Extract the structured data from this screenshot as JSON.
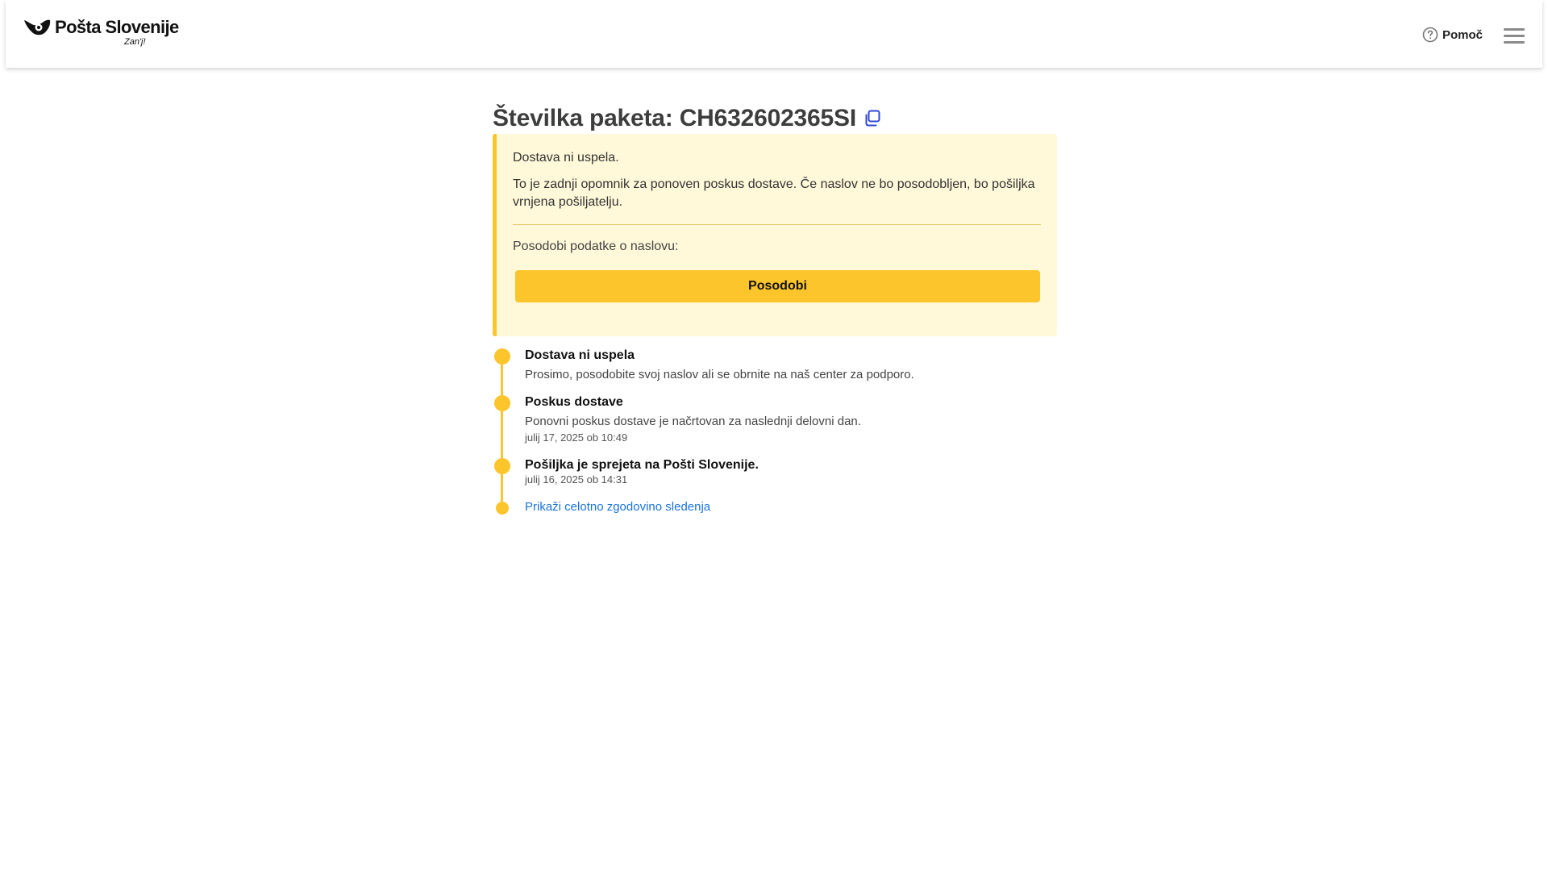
{
  "header": {
    "logo_name": "Pošta Slovenije",
    "logo_tagline": "Zan'j!",
    "help_label": "Pomoč",
    "menu_icon": "hamburger-menu-icon"
  },
  "parcel": {
    "title": "Številka paketa: CH632602365SI",
    "copy_icon": "copy-icon"
  },
  "alert": {
    "status": "Dostava ni uspela.",
    "message": "To je zadnji opomnik za ponoven poskus dostave. Če naslov ne bo posodobljen, bo pošiljka vrnjena pošiljatelju.",
    "prompt": "Posodobi podatke o naslovu:",
    "button_label": "Posodobi"
  },
  "timeline": {
    "events": [
      {
        "title": "Dostava ni uspela",
        "description": "Prosimo, posodobite svoj naslov ali se obrnite na naš center za podporo."
      },
      {
        "title": "Poskus dostave",
        "description": "Ponovni poskus dostave je načrtovan za naslednji delovni dan.",
        "time": "julij 17, 2025 ob 10:49"
      },
      {
        "title": "Pošiljka je sprejeta na Pošti Slovenije.",
        "time": "julij 16, 2025 ob 14:31"
      }
    ],
    "history_link": "Prikaži celotno zgodovino sledenja"
  },
  "colors": {
    "accent": "#fcc52c",
    "alert_background": "#fff8d9",
    "link": "#1a73d9"
  }
}
